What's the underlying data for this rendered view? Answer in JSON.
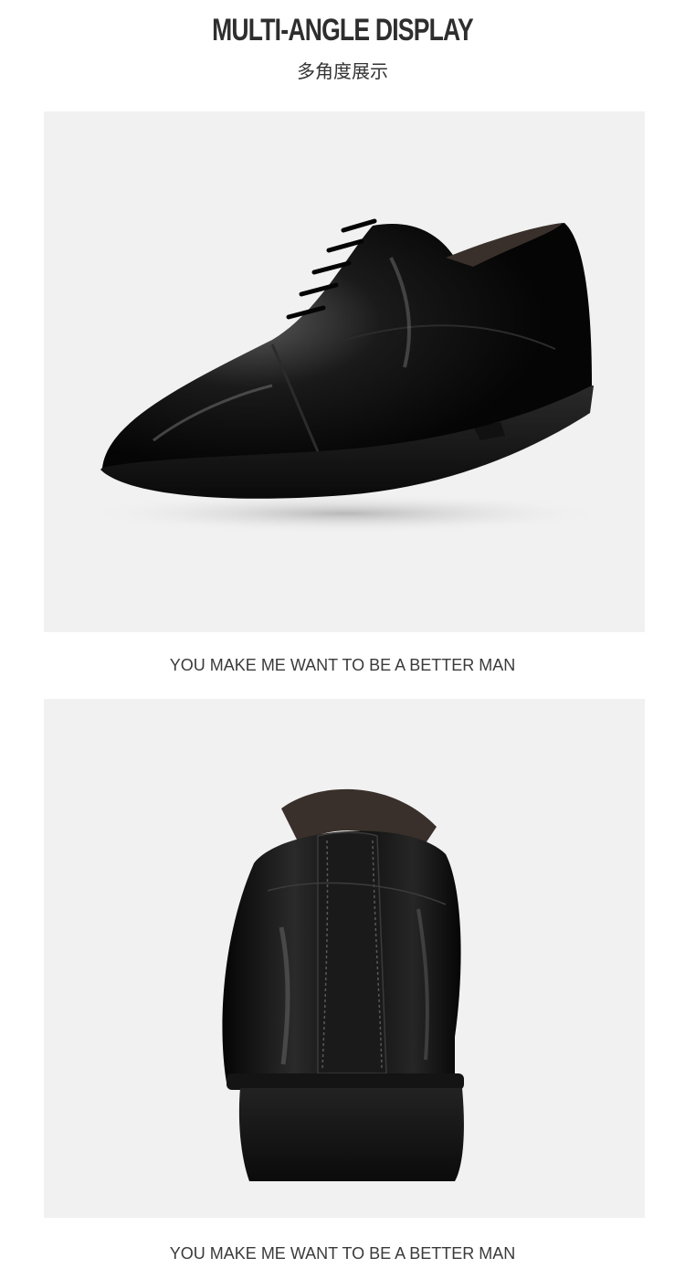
{
  "header": {
    "title": "MULTI-ANGLE DISPLAY",
    "subtitle": "多角度展示"
  },
  "gallery": {
    "items": [
      {
        "view": "side",
        "caption": "YOU MAKE ME WANT TO BE A BETTER MAN"
      },
      {
        "view": "back",
        "caption": "YOU MAKE ME WANT TO BE A BETTER MAN"
      }
    ]
  },
  "colors": {
    "panel_bg": "#f1f1f1",
    "leather": "#0c0c0c",
    "sole": "#161616",
    "lining": "#3a302b"
  }
}
